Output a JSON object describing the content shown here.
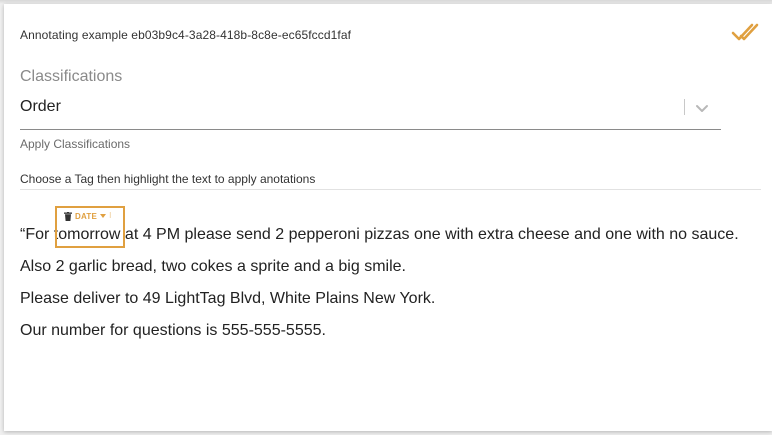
{
  "header": {
    "title": "Annotating example eb03b9c4-3a28-418b-8c8e-ec65fccd1faf",
    "done_icon": "double-check-icon"
  },
  "classifications": {
    "label": "Classifications",
    "selected": "Order",
    "apply_label": "Apply Classifications"
  },
  "instruction": "Choose a Tag then highlight the text to apply anotations",
  "annotation": {
    "tag": "DATE",
    "more": "⁝",
    "text": "tomorrow",
    "color": "#e0a040"
  },
  "text": {
    "line1_prefix": "“For ",
    "line1_suffix": " at 4 PM please send 2 pepperoni pizzas one with extra cheese and one with no sauce.",
    "line2": "Also 2 garlic bread, two cokes a sprite and a big smile.",
    "line3": "Please deliver to 49 LightTag Blvd, White Plains New York.",
    "line4": "Our number for questions is 555-555-5555."
  },
  "colors": {
    "accent": "#e0a040",
    "muted": "#8a8a8a"
  }
}
